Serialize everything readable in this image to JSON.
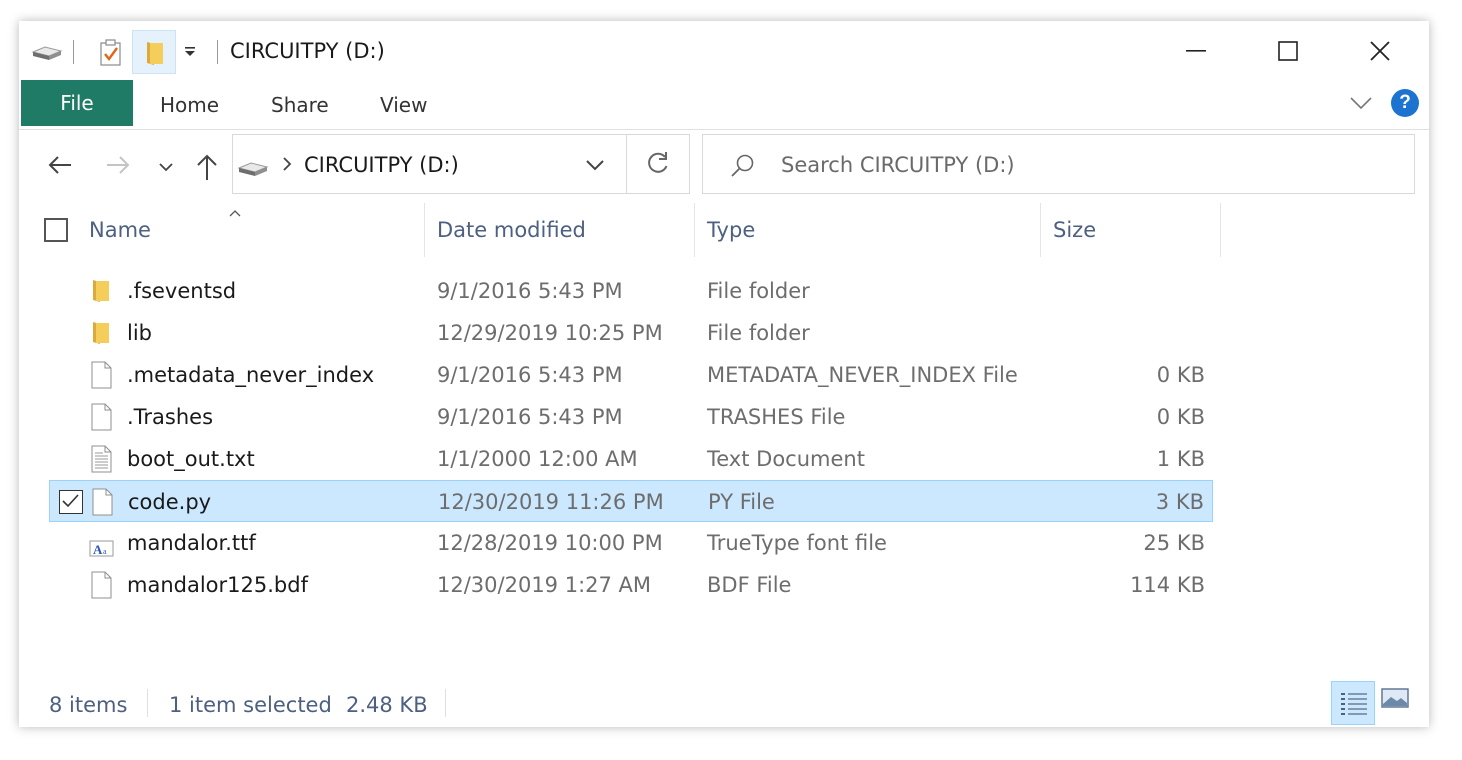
{
  "window": {
    "title": "CIRCUITPY (D:)"
  },
  "ribbon": {
    "tabs": [
      "File",
      "Home",
      "Share",
      "View"
    ],
    "help_label": "?"
  },
  "nav": {
    "address_path": "CIRCUITPY (D:)",
    "search_placeholder": "Search CIRCUITPY (D:)"
  },
  "columns": {
    "name": "Name",
    "date": "Date modified",
    "type": "Type",
    "size": "Size"
  },
  "files": [
    {
      "name": ".fseventsd",
      "date": "9/1/2016 5:43 PM",
      "type": "File folder",
      "size": "",
      "icon": "folder-icon"
    },
    {
      "name": "lib",
      "date": "12/29/2019 10:25 PM",
      "type": "File folder",
      "size": "",
      "icon": "folder-icon"
    },
    {
      "name": ".metadata_never_index",
      "date": "9/1/2016 5:43 PM",
      "type": "METADATA_NEVER_INDEX File",
      "size": "0 KB",
      "icon": "file-icon"
    },
    {
      "name": ".Trashes",
      "date": "9/1/2016 5:43 PM",
      "type": "TRASHES File",
      "size": "0 KB",
      "icon": "file-icon"
    },
    {
      "name": "boot_out.txt",
      "date": "1/1/2000 12:00 AM",
      "type": "Text Document",
      "size": "1 KB",
      "icon": "text-file-icon"
    },
    {
      "name": "code.py",
      "date": "12/30/2019 11:26 PM",
      "type": "PY File",
      "size": "3 KB",
      "icon": "file-icon",
      "selected": true
    },
    {
      "name": "mandalor.ttf",
      "date": "12/28/2019 10:00 PM",
      "type": "TrueType font file",
      "size": "25 KB",
      "icon": "font-file-icon"
    },
    {
      "name": "mandalor125.bdf",
      "date": "12/30/2019 1:27 AM",
      "type": "BDF File",
      "size": "114 KB",
      "icon": "file-icon"
    }
  ],
  "status": {
    "item_count": "8 items",
    "selection": "1 item selected",
    "selection_size": "2.48 KB"
  },
  "colors": {
    "file_tab": "#1f7a66",
    "selection_bg": "#cce8ff",
    "selection_border": "#99d1ff",
    "header_text": "#4d6082",
    "folder": "#f2c14e"
  }
}
